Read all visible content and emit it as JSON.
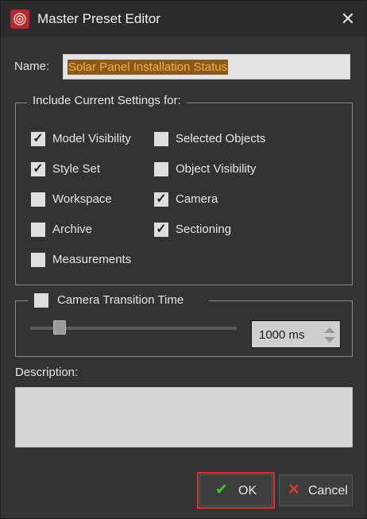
{
  "window": {
    "title": "Master Preset Editor",
    "app_icon": "app-logo-icon",
    "close_icon": "close-icon",
    "close_glyph": "✕"
  },
  "name": {
    "label": "Name:",
    "value": "Solar Panel Installation Status"
  },
  "settings": {
    "legend": "Include Current Settings for:",
    "items": [
      {
        "label": "Model Visibility",
        "checked": true,
        "glyph": "✓"
      },
      {
        "label": "Selected Objects",
        "checked": false,
        "glyph": ""
      },
      {
        "label": "Style Set",
        "checked": true,
        "glyph": "✓"
      },
      {
        "label": "Object Visibility",
        "checked": false,
        "glyph": ""
      },
      {
        "label": "Workspace",
        "checked": false,
        "glyph": ""
      },
      {
        "label": "Camera",
        "checked": true,
        "glyph": "✓"
      },
      {
        "label": "Archive",
        "checked": false,
        "glyph": ""
      },
      {
        "label": "Sectioning",
        "checked": true,
        "glyph": "✓"
      },
      {
        "label": "Measurements",
        "checked": false,
        "glyph": ""
      }
    ]
  },
  "camera_transition": {
    "label": "Camera Transition Time",
    "enabled": false,
    "slider_value_fraction": 0.12,
    "value": "1000 ms"
  },
  "description": {
    "label": "Description:",
    "value": ""
  },
  "buttons": {
    "ok": {
      "label": "OK",
      "icon": "checkmark-icon",
      "glyph": "✔"
    },
    "cancel": {
      "label": "Cancel",
      "icon": "x-icon",
      "glyph": "✕"
    }
  },
  "colors": {
    "background": "#333333",
    "selection_bg": "#8a5a1c",
    "selection_text": "#f2b040",
    "ok_icon": "#4bbf3a",
    "cancel_icon": "#d23a3a",
    "highlight_outline": "#e0322f"
  }
}
